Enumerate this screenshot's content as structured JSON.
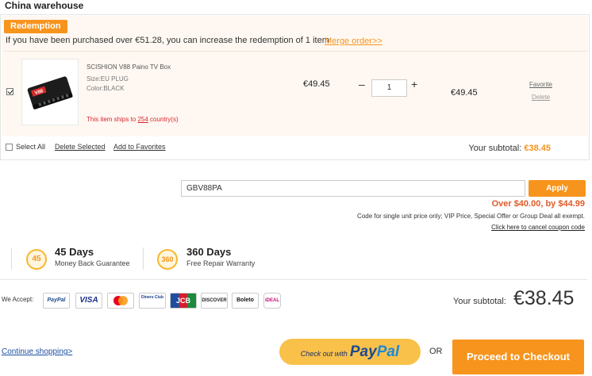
{
  "warehouse": {
    "title": "China warehouse"
  },
  "redemption": {
    "tag": "Redemption",
    "message": "If you have been purchased over €51.28, you can increase the redemption of 1 item",
    "merge_link": "Merge order>>"
  },
  "item": {
    "name": "SCISHION V88 Paino TV Box",
    "size": "Size:EU PLUG",
    "color": "Color:BLACK",
    "ship_prefix": "This item ships to ",
    "ship_count": "254",
    "ship_suffix": " country(s)",
    "unit_price": "€49.45",
    "minus": "–",
    "quantity": "1",
    "plus": "+",
    "line_price": "€49.45",
    "favorite": "Favorite",
    "delete": "Delete",
    "checked": true,
    "product_label": "V88"
  },
  "cart_actions": {
    "select_all": "Select All",
    "delete_selected": "Delete Selected",
    "add_to_favorites": "Add to Favorites",
    "subtotal_label": "Your subtotal:",
    "subtotal_value": "€38.45"
  },
  "coupon": {
    "code": "GBV88PA",
    "apply_label": "Apply",
    "result": "Over $40.00, by $44.99",
    "note": "Code for single unit price only; VIP Price, Special Offer or Group Deal all exempt.",
    "cancel_link": "Click here to cancel coupon code"
  },
  "guarantees": [
    {
      "badge": "45",
      "title": "45 Days",
      "subtitle": "Money Back Guarantee"
    },
    {
      "badge": "360",
      "title": "360 Days",
      "subtitle": "Free Repair Warranty"
    }
  ],
  "payment": {
    "we_accept": "We Accept:",
    "methods": [
      "PayPal",
      "VISA",
      "MasterCard",
      "Diners Club",
      "JCB",
      "DISCOVER",
      "Boleto",
      "iDEAL"
    ]
  },
  "totals": {
    "label": "Your subtotal:",
    "value": "€38.45"
  },
  "footer": {
    "continue": "Continue shopping>",
    "paypal_pre": "Check out with",
    "paypal_pay": "Pay",
    "paypal_pal": "Pal",
    "or": "OR",
    "checkout": "Proceed to Checkout"
  },
  "colors": {
    "accent": "#f7941d",
    "redemption_bg": "#fff8f2",
    "ship_note": "#d9232e",
    "paypal_btn": "#f9c14a"
  }
}
